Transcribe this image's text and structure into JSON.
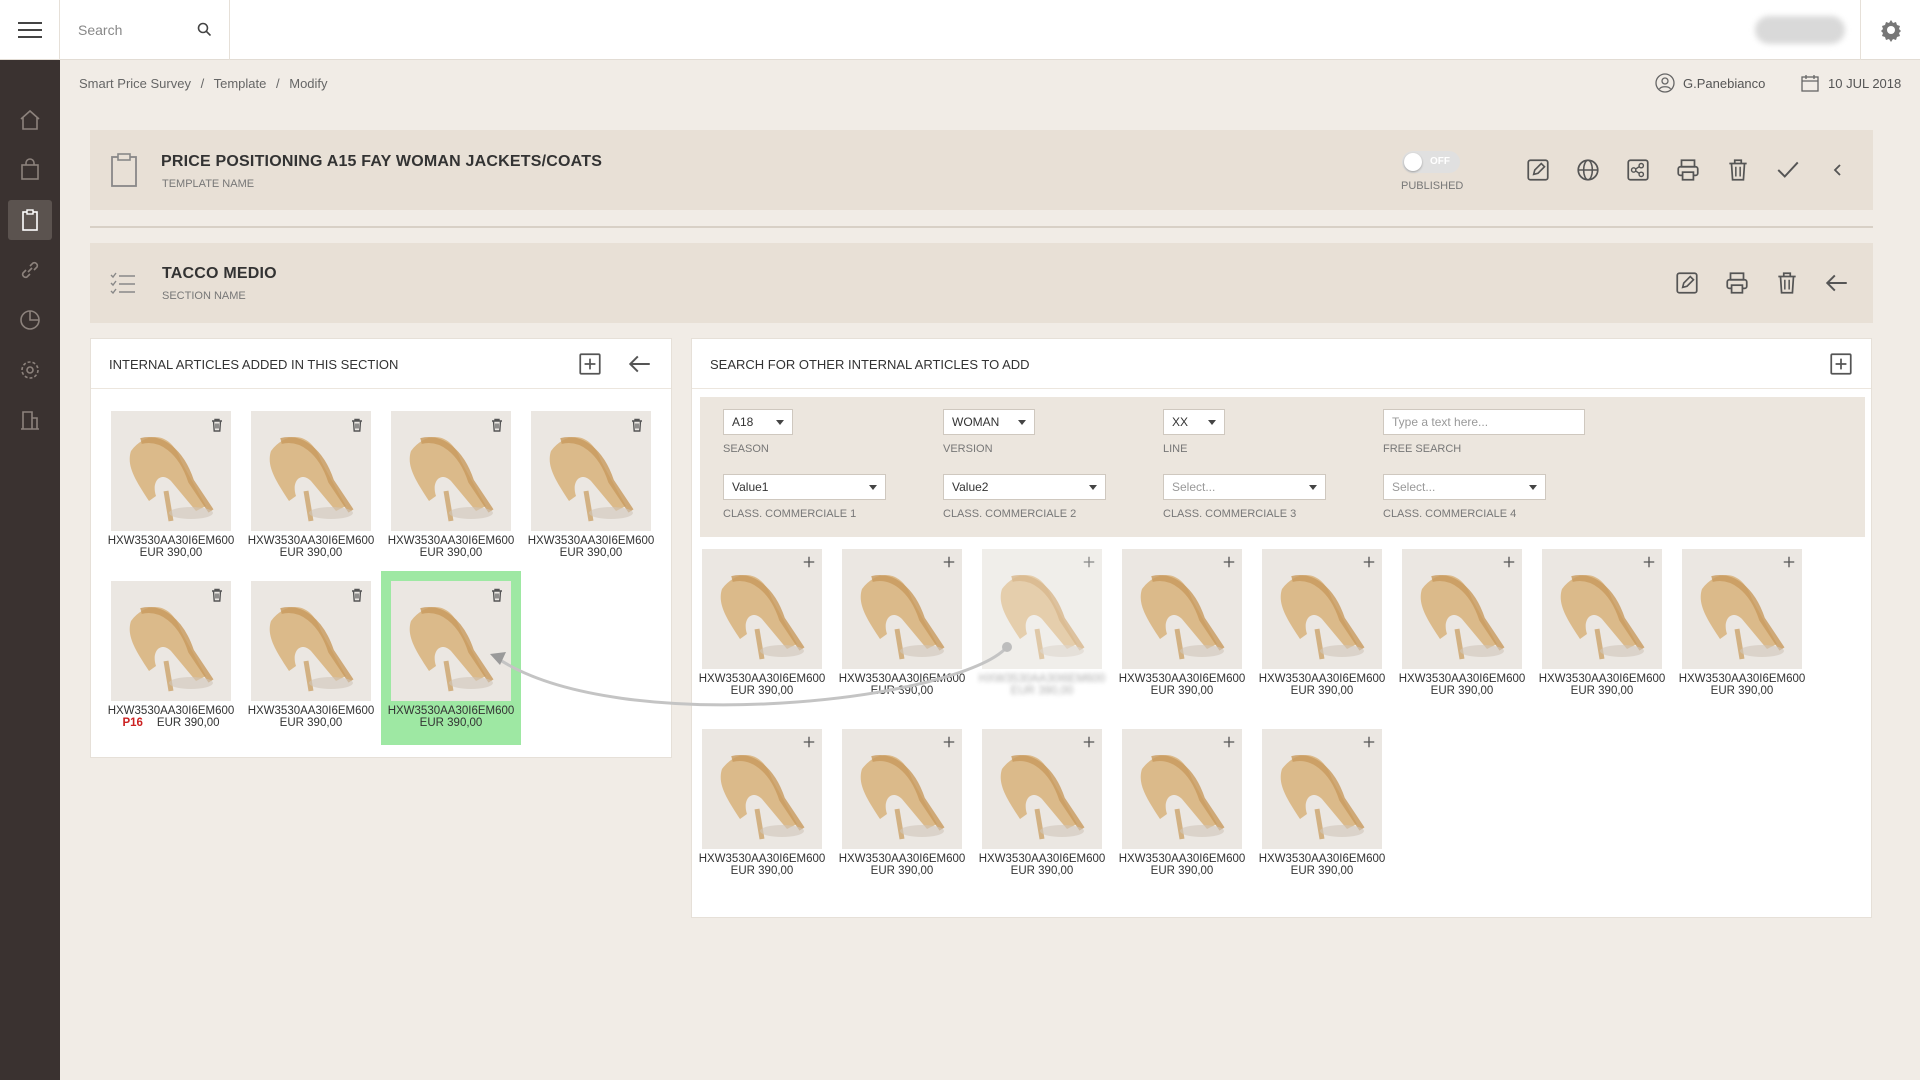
{
  "topbar": {
    "search_placeholder": "Search"
  },
  "breadcrumb": {
    "items": [
      "Smart Price Survey",
      "Template",
      "Modify"
    ],
    "separator": "/"
  },
  "user": {
    "name": "G.Panebianco"
  },
  "date": "10 JUL 2018",
  "template": {
    "title": "PRICE POSITIONING A15 FAY WOMAN JACKETS/COATS",
    "subtitle": "TEMPLATE NAME",
    "published_toggle": {
      "state": "OFF",
      "label": "PUBLISHED"
    }
  },
  "section": {
    "title": "TACCO MEDIO",
    "subtitle": "SECTION NAME"
  },
  "left_panel": {
    "title": "INTERNAL ARTICLES ADDED IN THIS SECTION",
    "articles": [
      {
        "code": "HXW3530AA30I6EM600",
        "price": "EUR 390,00"
      },
      {
        "code": "HXW3530AA30I6EM600",
        "price": "EUR 390,00"
      },
      {
        "code": "HXW3530AA30I6EM600",
        "price": "EUR 390,00"
      },
      {
        "code": "HXW3530AA30I6EM600",
        "price": "EUR 390,00"
      },
      {
        "code": "HXW3530AA30I6EM600",
        "price": "EUR 390,00",
        "tag": "P16"
      },
      {
        "code": "HXW3530AA30I6EM600",
        "price": "EUR 390,00"
      },
      {
        "code": "HXW3530AA30I6EM600",
        "price": "EUR 390,00"
      }
    ]
  },
  "right_panel": {
    "title": "SEARCH FOR OTHER INTERNAL ARTICLES TO ADD",
    "filters": {
      "season": {
        "value": "A18",
        "label": "SEASON"
      },
      "version": {
        "value": "WOMAN",
        "label": "VERSION"
      },
      "line": {
        "value": "XX",
        "label": "LINE"
      },
      "free_search": {
        "placeholder": "Type a text here...",
        "label": "FREE SEARCH"
      },
      "class1": {
        "value": "Value1",
        "label": "CLASS. COMMERCIALE 1"
      },
      "class2": {
        "value": "Value2",
        "label": "CLASS. COMMERCIALE 2"
      },
      "class3": {
        "value": "Select...",
        "label": "CLASS. COMMERCIALE 3"
      },
      "class4": {
        "value": "Select...",
        "label": "CLASS. COMMERCIALE 4"
      }
    },
    "articles": [
      {
        "code": "HXW3530AA30I6EM600",
        "price": "EUR 390,00"
      },
      {
        "code": "HXW3530AA30I6EM600",
        "price": "EUR 390,00"
      },
      {
        "code": "HXW3530AA30I6EM600",
        "price": "EUR 390,00"
      },
      {
        "code": "HXW3530AA30I6EM600",
        "price": "EUR 390,00"
      },
      {
        "code": "HXW3530AA30I6EM600",
        "price": "EUR 390,00"
      },
      {
        "code": "HXW3530AA30I6EM600",
        "price": "EUR 390,00"
      },
      {
        "code": "HXW3530AA30I6EM600",
        "price": "EUR 390,00"
      },
      {
        "code": "HXW3530AA30I6EM600",
        "price": "EUR 390,00"
      },
      {
        "code": "HXW3530AA30I6EM600",
        "price": "EUR 390,00"
      },
      {
        "code": "HXW3530AA30I6EM600",
        "price": "EUR 390,00"
      },
      {
        "code": "HXW3530AA30I6EM600",
        "price": "EUR 390,00"
      },
      {
        "code": "HXW3530AA30I6EM600",
        "price": "EUR 390,00"
      },
      {
        "code": "HXW3530AA30I6EM600",
        "price": "EUR 390,00"
      }
    ]
  },
  "colors": {
    "sidebar": "#3a3230",
    "header_panel": "#e8e0d6",
    "highlight": "#9ee8a3",
    "tag": "#cc2222"
  }
}
